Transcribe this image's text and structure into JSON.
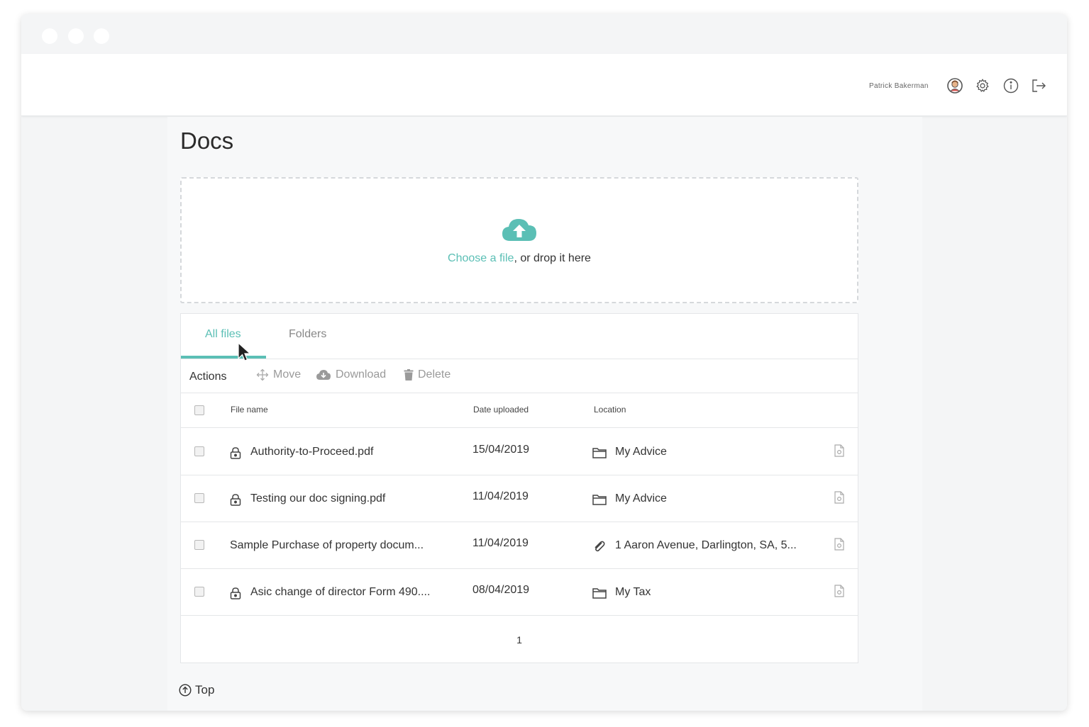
{
  "header": {
    "user_name": "Patrick Bakerman",
    "icons": [
      "avatar-icon",
      "settings-gear-icon",
      "info-icon",
      "logout-icon"
    ]
  },
  "page": {
    "title": "Docs"
  },
  "dropzone": {
    "link_text": "Choose a file",
    "rest_text": ", or drop it here",
    "icon": "cloud-upload-icon",
    "accent_color": "#5bbfb5"
  },
  "tabs": [
    {
      "label": "All files",
      "active": true
    },
    {
      "label": "Folders",
      "active": false
    }
  ],
  "actions": {
    "label": "Actions",
    "move": "Move",
    "download": "Download",
    "delete": "Delete"
  },
  "table": {
    "columns": [
      "File name",
      "Date uploaded",
      "Location"
    ],
    "rows": [
      {
        "name": "Authority-to-Proceed.pdf",
        "locked": true,
        "date": "15/04/2019",
        "location": "My Advice",
        "location_icon": "folder-icon"
      },
      {
        "name": "Testing our doc signing.pdf",
        "locked": true,
        "date": "11/04/2019",
        "location": "My Advice",
        "location_icon": "folder-icon"
      },
      {
        "name": "Sample Purchase of property docum...",
        "locked": false,
        "date": "11/04/2019",
        "location": "1 Aaron Avenue, Darlington, SA, 5...",
        "location_icon": "paperclip-icon"
      },
      {
        "name": "Asic change of director Form 490....",
        "locked": true,
        "date": "08/04/2019",
        "location": "My Tax",
        "location_icon": "folder-icon"
      }
    ]
  },
  "pagination": {
    "current_page": "1"
  },
  "footer": {
    "top_label": "Top"
  }
}
